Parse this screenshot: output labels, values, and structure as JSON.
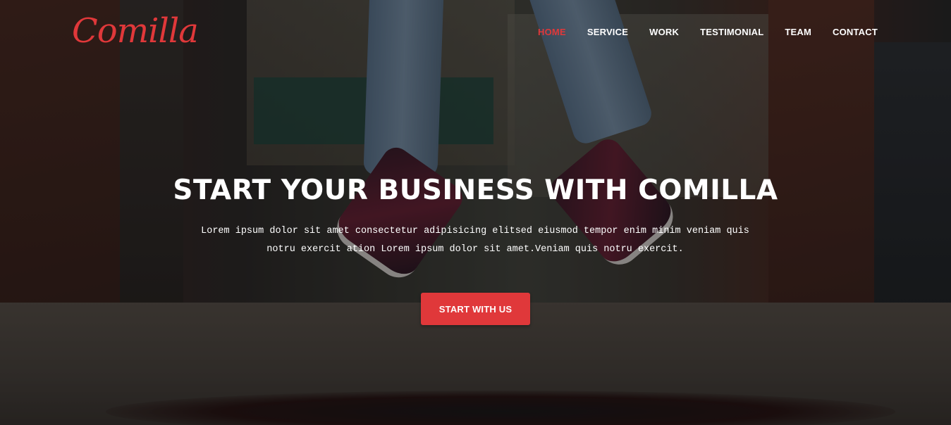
{
  "header": {
    "logo_text": "Comilla",
    "nav": [
      {
        "label": "HOME",
        "active": true
      },
      {
        "label": "SERVICE",
        "active": false
      },
      {
        "label": "WORK",
        "active": false
      },
      {
        "label": "TESTIMONIAL",
        "active": false
      },
      {
        "label": "TEAM",
        "active": false
      },
      {
        "label": "CONTACT",
        "active": false
      }
    ]
  },
  "hero": {
    "title": "START YOUR BUSINESS WITH COMILLA",
    "description": "Lorem ipsum dolor sit amet consectetur adipisicing elitsed eiusmod tempor enim minim veniam quis notru exercit ation Lorem ipsum dolor sit amet.Veniam quis notru exercit.",
    "cta_label": "START WITH US"
  },
  "colors": {
    "accent": "#e0383a",
    "text": "#ffffff"
  }
}
